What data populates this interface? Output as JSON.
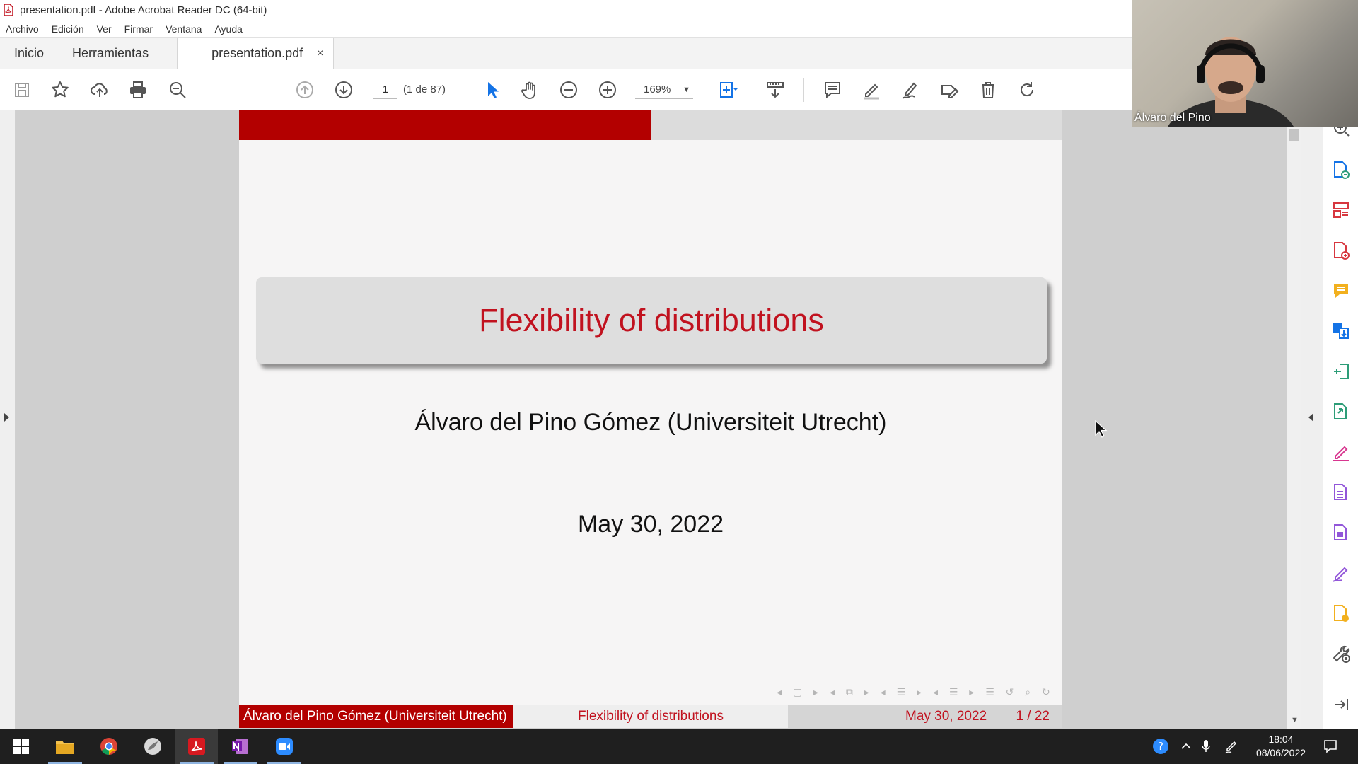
{
  "window": {
    "title": "presentation.pdf - Adobe Acrobat Reader DC (64-bit)"
  },
  "menu": [
    "Archivo",
    "Edición",
    "Ver",
    "Firmar",
    "Ventana",
    "Ayuda"
  ],
  "tabs": {
    "home": "Inicio",
    "tools": "Herramientas",
    "document": "presentation.pdf",
    "close": "×"
  },
  "toolbar": {
    "page_number": "1",
    "page_count": "(1 de 87)",
    "zoom": "169%"
  },
  "slide": {
    "title": "Flexibility of distributions",
    "author": "Álvaro del Pino Gómez (Universiteit Utrecht)",
    "date": "May 30, 2022",
    "footer": {
      "author": "Álvaro del Pino Gómez (Universiteit Utrecht)",
      "title": "Flexibility of distributions",
      "date": "May 30, 2022",
      "page": "1 / 22"
    },
    "colors": {
      "accent": "#b30000",
      "title_text": "#c1121f"
    }
  },
  "webcam": {
    "name": "Álvaro del Pino"
  },
  "taskbar": {
    "time": "18:04",
    "date": "08/06/2022"
  },
  "icons": {
    "toolbar": [
      "save-icon",
      "bookmark-star-icon",
      "upload-icon",
      "print-icon",
      "zoom-search-icon",
      "page-up-icon",
      "page-down-icon",
      "select-cursor-icon",
      "hand-tool-icon",
      "zoom-out-icon",
      "zoom-in-icon",
      "fit-page-icon",
      "scroll-mode-icon",
      "comment-icon",
      "highlight-pen-icon",
      "draw-icon",
      "fill-sign-icon",
      "delete-icon",
      "rotate-icon"
    ],
    "right_pane": [
      "search-zoom-icon",
      "export-pdf-icon",
      "organize-pages-icon",
      "create-pdf-icon",
      "comment-icon",
      "combine-files-icon",
      "edit-pdf-icon",
      "send-icon",
      "fill-sign-icon",
      "scan-icon",
      "protect-icon",
      "request-signature-icon",
      "share-icon",
      "more-tools-icon",
      "collapse-pane-icon"
    ]
  }
}
